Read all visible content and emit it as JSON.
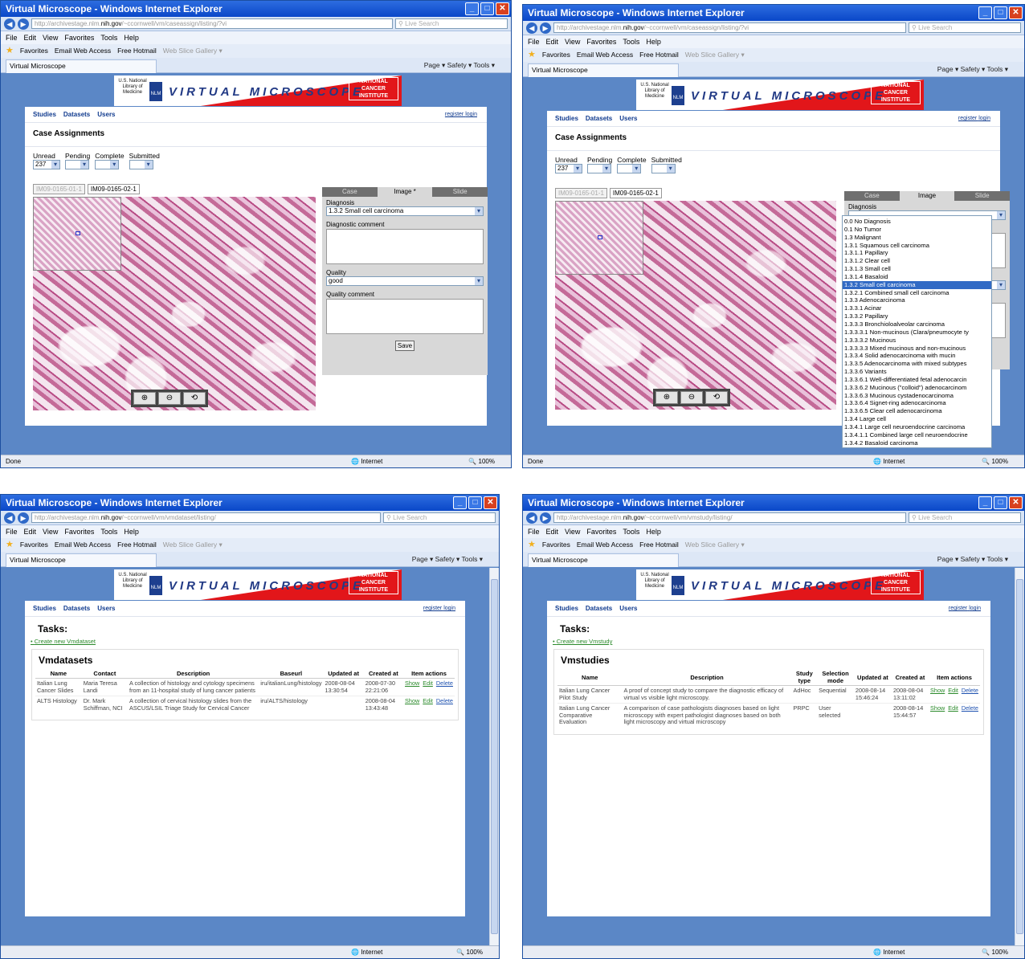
{
  "browser": {
    "title": "Virtual Microscope - Windows Internet Explorer",
    "address_prefix": "http://archivestage.nlm.",
    "address_bold": "nih.gov",
    "url1_suffix": "/~ccornwell/vm/caseassign/listing/?vi",
    "url3_suffix": "/~ccornwell/vm/vmdataset/listing/",
    "url4_suffix": "/~ccornwell/vm/vmstudy/listing/",
    "search_placeholder": "Live Search",
    "menu": [
      "File",
      "Edit",
      "View",
      "Favorites",
      "Tools",
      "Help"
    ],
    "favorites_label": "Favorites",
    "fav_links": [
      "Email Web Access",
      "Free Hotmail",
      "Web Slice Gallery ▾"
    ],
    "tab_label": "Virtual Microscope",
    "command_tools": "Page ▾   Safety ▾   Tools ▾",
    "status_done": "Done",
    "status_internet": "Internet",
    "status_zoom": "100%"
  },
  "site": {
    "nlm_text": "U.S. National Library of Medicine",
    "nlm_box": "NLM",
    "brand": "VIRTUAL MICROSCOPE",
    "nci": "NATIONAL CANCER INSTITUTE",
    "nav": [
      "Studies",
      "Datasets",
      "Users"
    ],
    "register": "register",
    "login": "login"
  },
  "case": {
    "title": "Case Assignments",
    "filters": [
      {
        "label": "Unread",
        "value": "237"
      },
      {
        "label": "Pending",
        "value": ""
      },
      {
        "label": "Complete",
        "value": ""
      },
      {
        "label": "Submitted",
        "value": ""
      }
    ],
    "image_tabs": [
      "IM09-0165-01-1",
      "IM09-0165-02-1"
    ],
    "side_tabs_a": [
      "Case",
      "Image *",
      "Slide"
    ],
    "side_tabs_b": [
      "Case",
      "Image",
      "Slide"
    ],
    "diagnosis_label": "Diagnosis",
    "diagnosis_value": "1.3.2 Small cell carcinoma",
    "diag_comment_label": "Diagnostic comment",
    "quality_label": "Quality",
    "quality_value": "good",
    "quality_comment_label": "Quality comment",
    "save": "Save",
    "zoom_buttons": [
      "⊕",
      "⊖",
      "⟲"
    ],
    "diagnosis_options": [
      "0.0 No Diagnosis",
      "0.1 No Tumor",
      "1.3 Malignant",
      "1.3.1 Squamous cell carcinoma",
      "1.3.1.1 Papillary",
      "1.3.1.2 Clear cell",
      "1.3.1.3 Small cell",
      "1.3.1.4 Basaloid",
      "1.3.2 Small cell carcinoma",
      "1.3.2.1 Combined small cell carcinoma",
      "1.3.3 Adenocarcinoma",
      "1.3.3.1 Acinar",
      "1.3.3.2 Papillary",
      "1.3.3.3 Bronchioloalveolar carcinoma",
      "1.3.3.3.1 Non-mucinous (Clara/pneumocyte ty",
      "1.3.3.3.2 Mucinous",
      "1.3.3.3.3 Mixed mucinous and non-mucinous",
      "1.3.3.4 Solid adenocarcinoma with mucin",
      "1.3.3.5 Adenocarcinoma with mixed subtypes",
      "1.3.3.6 Variants",
      "1.3.3.6.1 Well-differentiated fetal adenocarcin",
      "1.3.3.6.2 Mucinous (\"colloid\") adenocarcinom",
      "1.3.3.6.3 Mucinous cystadenocarcinoma",
      "1.3.3.6.4 Signet-ring adenocarcinoma",
      "1.3.3.6.5 Clear cell adenocarcinoma",
      "1.3.4 Large cell",
      "1.3.4.1 Large cell neuroendocrine carcinoma",
      "1.3.4.1.1 Combined large cell neuroendocrine",
      "1.3.4.2 Basaloid carcinoma"
    ],
    "diagnosis_selected_index": 8
  },
  "tasks_label": "Tasks:",
  "datasets": {
    "create_link": "Create new Vmdataset",
    "title": "Vmdatasets",
    "headers": [
      "Name",
      "Contact",
      "Description",
      "Baseurl",
      "Updated at",
      "Created at",
      "Item actions"
    ],
    "rows": [
      {
        "name": "Italian Lung Cancer Slides",
        "contact": "Maria Teresa Landi",
        "description": "A collection of histology and cytology specimens from an 11-hospital study of lung cancer patients",
        "baseurl": "iru/italianLung/histology",
        "updated": "2008-08-04 13:30:54",
        "created": "2008-07-30 22:21:06"
      },
      {
        "name": "ALTS Histology",
        "contact": "Dr. Mark Schiffman, NCI",
        "description": "A collection of cervical histology slides from the ASCUS/LSIL Triage Study for Cervical Cancer",
        "baseurl": "iru/ALTS/histology",
        "updated": "",
        "created": "2008-08-04 13:43:48"
      }
    ],
    "actions": [
      "Show",
      "Edit",
      "Delete"
    ]
  },
  "studies": {
    "create_link": "Create new Vmstudy",
    "title": "Vmstudies",
    "headers": [
      "Name",
      "Description",
      "Study type",
      "Selection mode",
      "Updated at",
      "Created at",
      "Item actions"
    ],
    "rows": [
      {
        "name": "Italian Lung Cancer Pilot Study",
        "description": "A proof of concept study to compare the diagnostic efficacy of virtual vs visible light microscopy.",
        "type": "AdHoc",
        "mode": "Sequential",
        "updated": "2008-08-14 15:46:24",
        "created": "2008-08-04 13:11:02"
      },
      {
        "name": "Italian Lung Cancer Comparative Evaluation",
        "description": "A comparison of case pathologists diagnoses based on light microscopy with expert pathologist diagnoses based on both light microscopy and virtual microscopy",
        "type": "PRPC",
        "mode": "User selected",
        "updated": "",
        "created": "2008-08-14 15:44:57"
      }
    ],
    "actions": [
      "Show",
      "Edit",
      "Delete"
    ]
  }
}
